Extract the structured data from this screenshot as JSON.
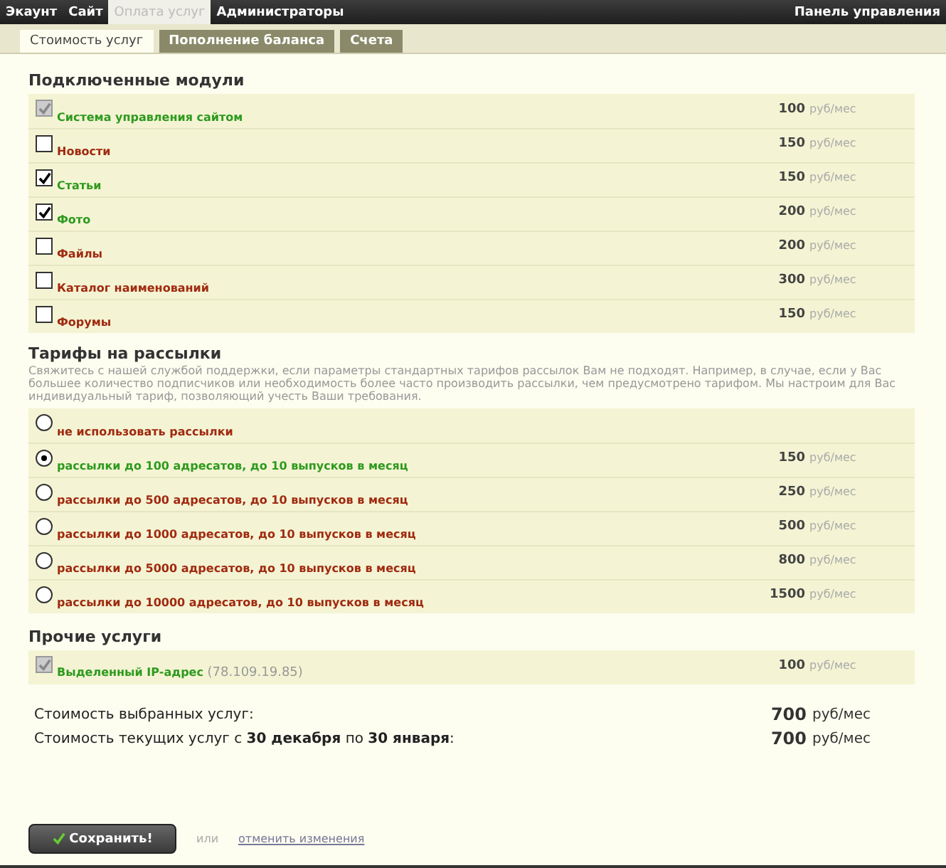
{
  "nav": {
    "items": [
      {
        "label": "Экаунт",
        "selected": false
      },
      {
        "label": "Сайт",
        "selected": false
      },
      {
        "label": "Оплата услуг",
        "selected": true
      },
      {
        "label": "Администраторы",
        "selected": false
      }
    ],
    "right_link": "Панель управления"
  },
  "tabs": [
    {
      "label": "Стоимость услуг",
      "selected": true
    },
    {
      "label": "Пополнение баланса",
      "selected": false
    },
    {
      "label": "Счета",
      "selected": false
    }
  ],
  "modules": {
    "title": "Подключенные модули",
    "items": [
      {
        "name": "Система управления сайтом",
        "checked": true,
        "disabled": true,
        "price": "100",
        "unit": "руб/мес"
      },
      {
        "name": "Новости",
        "checked": false,
        "disabled": false,
        "price": "150",
        "unit": "руб/мес"
      },
      {
        "name": "Статьи",
        "checked": true,
        "disabled": false,
        "price": "150",
        "unit": "руб/мес"
      },
      {
        "name": "Фото",
        "checked": true,
        "disabled": false,
        "price": "200",
        "unit": "руб/мес"
      },
      {
        "name": "Файлы",
        "checked": false,
        "disabled": false,
        "price": "200",
        "unit": "руб/мес"
      },
      {
        "name": "Каталог наименований",
        "checked": false,
        "disabled": false,
        "price": "300",
        "unit": "руб/мес"
      },
      {
        "name": "Форумы",
        "checked": false,
        "disabled": false,
        "price": "150",
        "unit": "руб/мес"
      }
    ]
  },
  "mailing": {
    "title": "Тарифы на рассылки",
    "description": "Свяжитесь с нашей службой поддержки, если параметры стандартных тарифов рассылок Вам не подходят. Например, в случае, если у Вас большее количество подписчиков или необходимость более часто производить рассылки, чем предусмотрено тарифом. Мы настроим для Вас индивидуальный тариф, позволяющий учесть Ваши требования.",
    "items": [
      {
        "name": "не использовать рассылки",
        "selected": false
      },
      {
        "name": "рассылки до 100 адресатов, до 10 выпусков в месяц",
        "selected": true,
        "price": "150",
        "unit": "руб/мес"
      },
      {
        "name": "рассылки до 500 адресатов, до 10 выпусков в месяц",
        "selected": false,
        "price": "250",
        "unit": "руб/мес"
      },
      {
        "name": "рассылки до 1000 адресатов, до 10 выпусков в месяц",
        "selected": false,
        "price": "500",
        "unit": "руб/мес"
      },
      {
        "name": "рассылки до 5000 адресатов, до 10 выпусков в месяц",
        "selected": false,
        "price": "800",
        "unit": "руб/мес"
      },
      {
        "name": "рассылки до 10000 адресатов, до 10 выпусков в месяц",
        "selected": false,
        "price": "1500",
        "unit": "руб/мес"
      }
    ]
  },
  "other": {
    "title": "Прочие услуги",
    "items": [
      {
        "name": "Выделенный IP-адрес",
        "note": "(78.109.19.85)",
        "checked": true,
        "disabled": true,
        "price": "100",
        "unit": "руб/мес"
      }
    ]
  },
  "totals": [
    {
      "label": "Стоимость выбранных услуг:",
      "amount": "700",
      "unit": "руб/мес"
    },
    {
      "label": "Стоимость текущих услуг с **30 декабря** по **30 января**:",
      "amount": "700",
      "unit": "руб/мес"
    }
  ],
  "actions": {
    "save": "Сохранить!",
    "or": "или",
    "cancel": "отменить изменения"
  }
}
